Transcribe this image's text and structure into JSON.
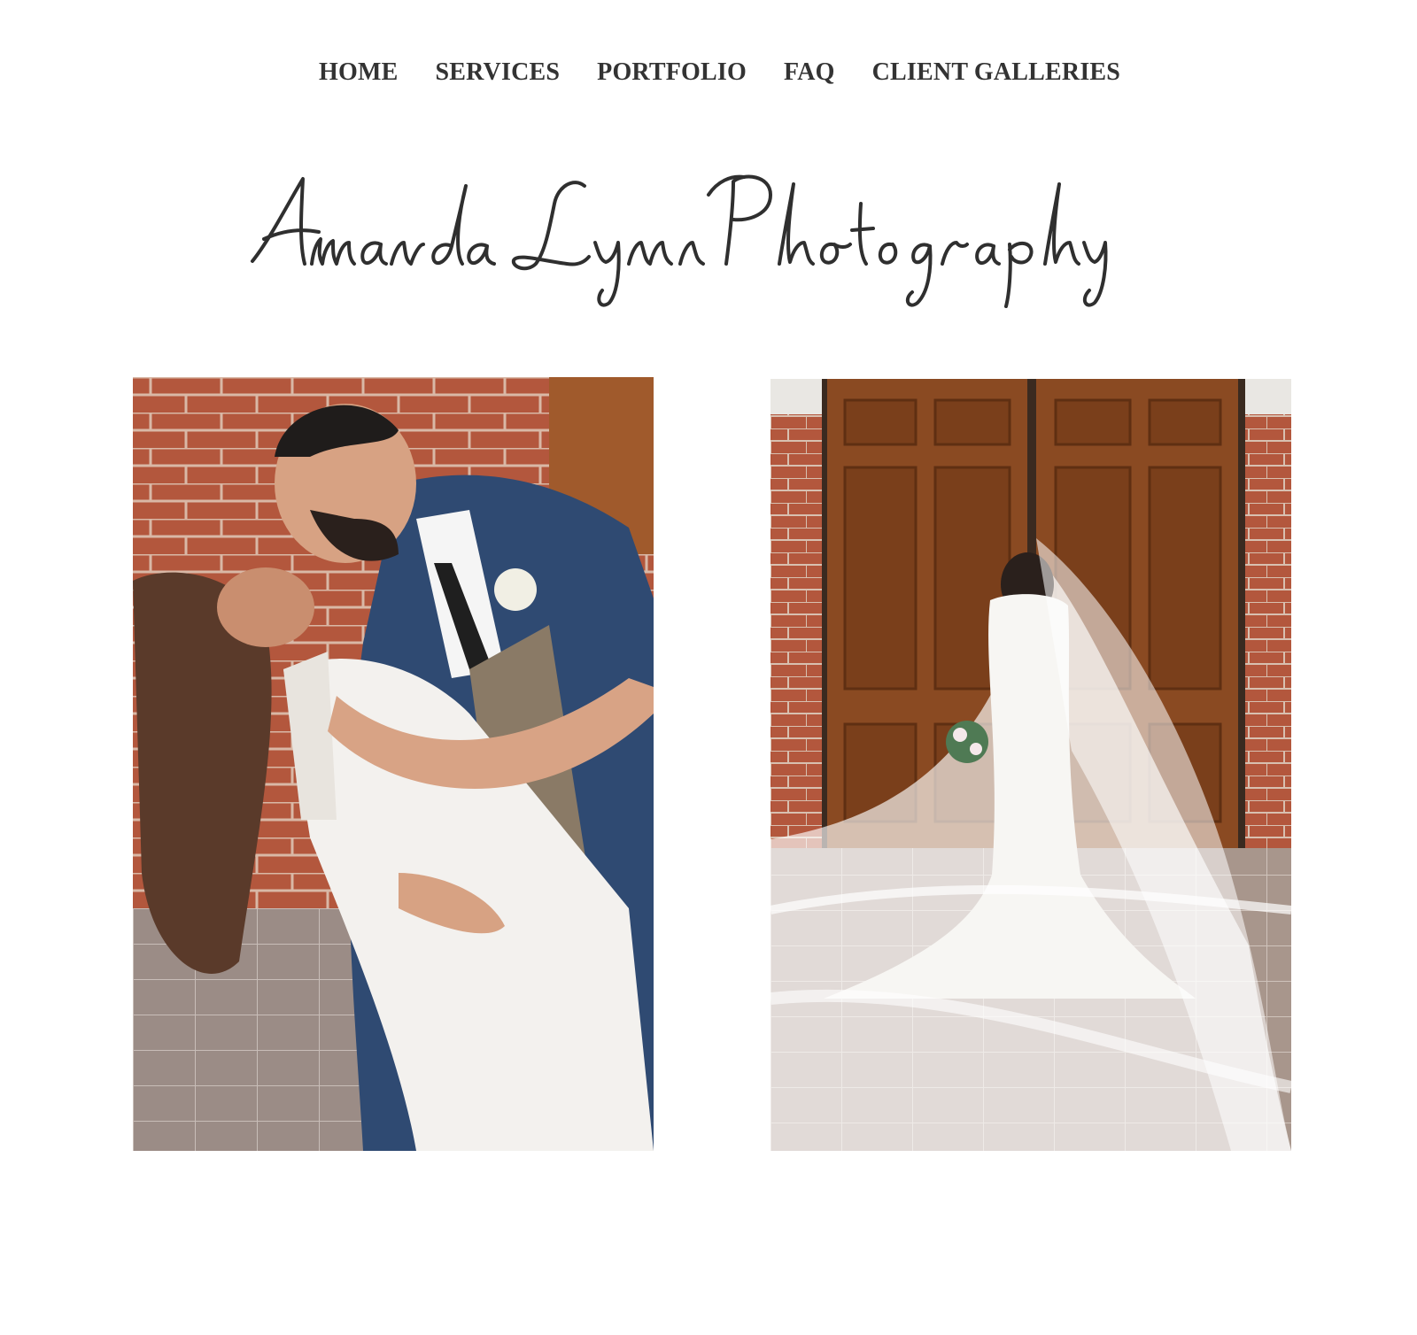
{
  "nav": {
    "items": [
      {
        "label": "HOME"
      },
      {
        "label": "SERVICES"
      },
      {
        "label": "PORTFOLIO"
      },
      {
        "label": "FAQ"
      },
      {
        "label": "CLIENT GALLERIES"
      }
    ]
  },
  "logo": {
    "text": "Amanda Lynn Photography"
  },
  "colors": {
    "text": "#2f2f2f",
    "background": "#ffffff",
    "brick": "#b5563a",
    "suit": "#2f4a72",
    "dress": "#f3f1ee",
    "door": "#8a4a22"
  }
}
